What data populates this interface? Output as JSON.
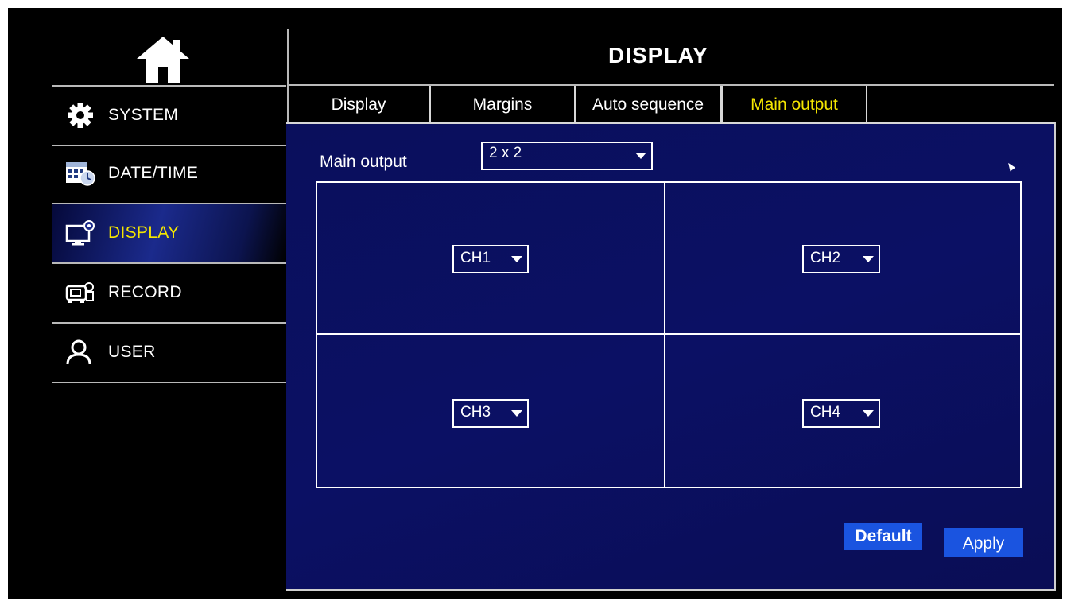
{
  "header": {
    "title": "DISPLAY"
  },
  "sidebar": {
    "home_icon": "home-icon",
    "items": [
      {
        "label": "SYSTEM",
        "icon": "gear-icon",
        "active": false
      },
      {
        "label": "DATE/TIME",
        "icon": "calendar-clock-icon",
        "active": false
      },
      {
        "label": "DISPLAY",
        "icon": "monitor-icon",
        "active": true
      },
      {
        "label": "RECORD",
        "icon": "camera-icon",
        "active": false
      },
      {
        "label": "USER",
        "icon": "user-icon",
        "active": false
      }
    ]
  },
  "tabs": [
    {
      "label": "Display",
      "active": false
    },
    {
      "label": "Margins",
      "active": false
    },
    {
      "label": "Auto sequence",
      "active": false
    },
    {
      "label": "Main output",
      "active": true
    }
  ],
  "main_output": {
    "label": "Main output",
    "layout_value": "2 x 2",
    "channels": [
      "CH1",
      "CH2",
      "CH3",
      "CH4"
    ]
  },
  "buttons": {
    "default_label": "Default",
    "apply_label": "Apply"
  },
  "colors": {
    "accent_active": "#f4e600",
    "panel_background": "#0a0f5c",
    "button_blue": "#1a54e0",
    "text": "#ffffff"
  }
}
